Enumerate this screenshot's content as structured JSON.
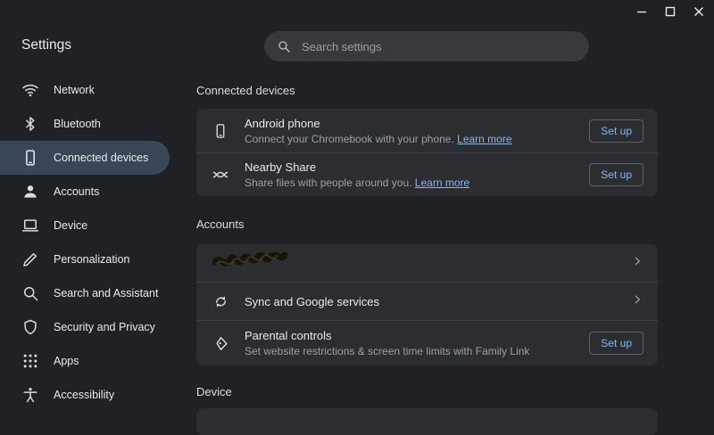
{
  "window_controls": {
    "minimize_icon": "minimize",
    "maximize_icon": "maximize",
    "close_icon": "close"
  },
  "header": {
    "title": "Settings",
    "search_placeholder": "Search settings",
    "search_icon": "magnifier"
  },
  "sidebar": {
    "items": [
      {
        "label": "Network",
        "icon": "wifi-icon"
      },
      {
        "label": "Bluetooth",
        "icon": "bluetooth-icon"
      },
      {
        "label": "Connected devices",
        "icon": "smartphone-icon",
        "selected": true
      },
      {
        "label": "Accounts",
        "icon": "person-icon"
      },
      {
        "label": "Device",
        "icon": "laptop-icon"
      },
      {
        "label": "Personalization",
        "icon": "pen-icon"
      },
      {
        "label": "Search and Assistant",
        "icon": "search-icon"
      },
      {
        "label": "Security and Privacy",
        "icon": "shield-icon"
      },
      {
        "label": "Apps",
        "icon": "apps-grid-icon"
      },
      {
        "label": "Accessibility",
        "icon": "accessibility-icon"
      }
    ]
  },
  "connected_devices": {
    "section_title": "Connected devices",
    "android_phone": {
      "title": "Android phone",
      "description": "Connect your Chromebook with your phone. ",
      "link_label": "Learn more",
      "button_label": "Set up",
      "icon": "smartphone-icon"
    },
    "nearby_share": {
      "title": "Nearby Share",
      "description": "Share files with people around you. ",
      "link_label": "Learn more",
      "button_label": "Set up",
      "icon": "nearby-share-icon"
    }
  },
  "accounts": {
    "section_title": "Accounts",
    "profile_row": {
      "redacted": true,
      "icon": "redacted-scribble"
    },
    "sync_row": {
      "title": "Sync and Google services",
      "icon": "sync-icon"
    },
    "parental_row": {
      "title": "Parental controls",
      "description": "Set website restrictions & screen time limits with Family Link",
      "button_label": "Set up",
      "icon": "family-link-icon"
    }
  },
  "device_section": {
    "section_title": "Device"
  },
  "colors": {
    "background": "#202124",
    "card_bg": "#2b2d30",
    "selected_nav_bg": "#394657",
    "accent": "#8ab4f8",
    "secondary_text": "#9aa0a6"
  }
}
